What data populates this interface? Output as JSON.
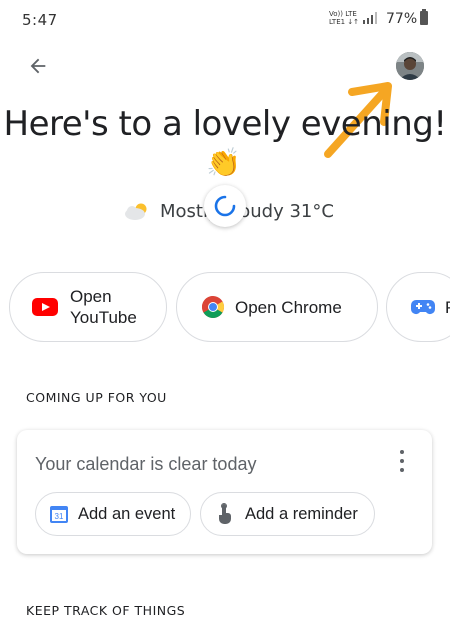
{
  "status_bar": {
    "time": "5:47",
    "network_top": "Vo)) LTE",
    "network_bottom": "LTE1 ↓↑",
    "battery": "77%"
  },
  "header": {
    "back_icon": "arrow-left-icon",
    "avatar": "user-avatar"
  },
  "greeting": {
    "text": "Here's to a lovely evening!",
    "emoji": "👏"
  },
  "weather": {
    "text": "Mostly cloudy 31°C",
    "icon": "partly-cloudy-icon"
  },
  "shortcuts": [
    {
      "label_line1": "Open",
      "label_line2": "YouTube",
      "icon": "youtube-icon"
    },
    {
      "label": "Open Chrome",
      "icon": "chrome-icon"
    },
    {
      "label": "P",
      "icon": "gamepad-icon"
    }
  ],
  "coming_up": {
    "heading": "COMING UP FOR YOU",
    "card_title": "Your calendar is clear today",
    "calendar_badge": "31",
    "actions": [
      {
        "label": "Add an event",
        "icon": "calendar-icon"
      },
      {
        "label": "Add a reminder",
        "icon": "reminder-hand-icon"
      }
    ]
  },
  "keep_track": {
    "heading": "KEEP TRACK OF THINGS"
  },
  "colors": {
    "annotation_arrow": "#F5A623",
    "youtube_red": "#FF0000",
    "google_blue": "#4285F4",
    "loader_blue": "#1A73E8"
  }
}
